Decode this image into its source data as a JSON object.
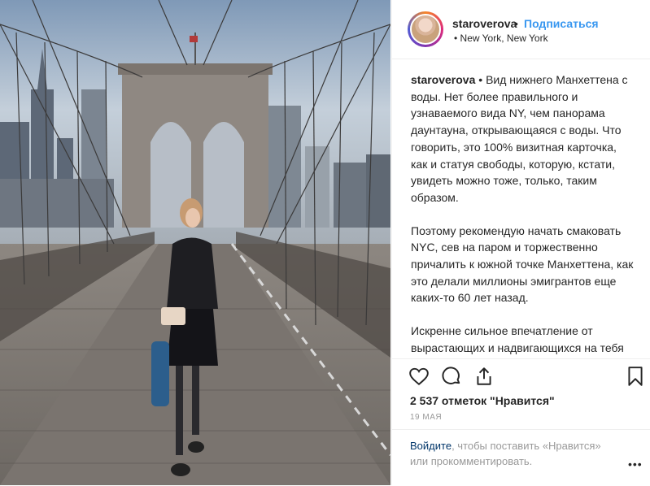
{
  "post": {
    "username": "staroverova",
    "separator": "•",
    "follow_label": "Подписаться",
    "location": "• New York, New York",
    "caption_user": "staroverova",
    "caption_p1": " • Вид нижнего Манхеттена с воды. Нет более правильного и узнаваемого вида NY, чем панорама даунтауна, открывающаяся с воды. Что говорить, это 100% визитная карточка, как и статуя свободы, которую, кстати, увидеть можно тоже, только, таким образом.",
    "caption_p2": "Поэтому рекомендую начать смаковать NYC, сев на паром и торжественно причалить к южной точке Манхеттена, как это делали миллионы эмигрантов еще каких-то 60 лет назад.",
    "caption_p3": "Искренне сильное впечатление от вырастающих и надвигающихся на тебя бетонных колоссов, а заодно и статуи свободы слева по ходу движения, что тоже конечно дарует волнение и трепет.",
    "likes": "2 537 отметок \"Нравится\"",
    "date": "19 МАЯ",
    "login_link": "Войдите",
    "login_text": ", чтобы поставить «Нравится» или прокомментировать.",
    "more": "•••"
  },
  "icons": {
    "like": "heart-icon",
    "comment": "comment-icon",
    "share": "share-icon",
    "save": "bookmark-icon"
  },
  "colors": {
    "link_blue": "#3897f0",
    "login_blue": "#003569",
    "muted": "#999999",
    "text": "#262626"
  }
}
